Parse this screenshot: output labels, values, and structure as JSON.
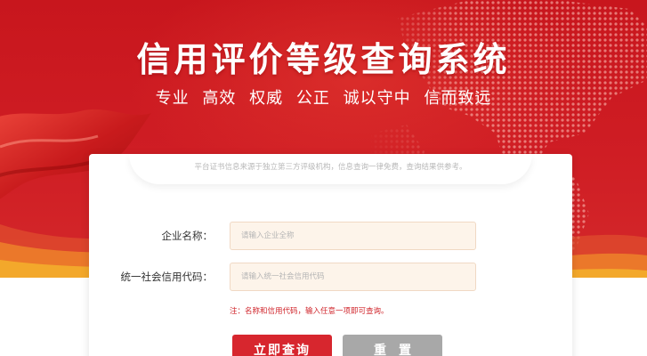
{
  "header": {
    "title": "信用评价等级查询系统",
    "slogans": [
      "专业",
      "高效",
      "权威",
      "公正",
      "诚以守中",
      "信而致远"
    ]
  },
  "card": {
    "notice": "平台证书信息来源于独立第三方评级机构，信息查询一律免费，查询结果供参考。",
    "fields": {
      "company_name": {
        "label": "企业名称：",
        "value": "",
        "placeholder": "请输入企业全称"
      },
      "credit_code": {
        "label": "统一社会信用代码：",
        "value": "",
        "placeholder": "请输入统一社会信用代码"
      }
    },
    "tip": "注：名称和信用代码，输入任意一项即可查询。",
    "buttons": {
      "query": "立即查询",
      "reset": "重置"
    }
  },
  "colors": {
    "brand_red": "#c8161d",
    "button_red": "#d7262e",
    "button_gray": "#a8a8a8",
    "input_bg": "#fdf4ea",
    "tip_red": "#d0262c"
  },
  "icons": [
    "world-map-graphic",
    "red-flag-graphic",
    "wave-decoration"
  ]
}
